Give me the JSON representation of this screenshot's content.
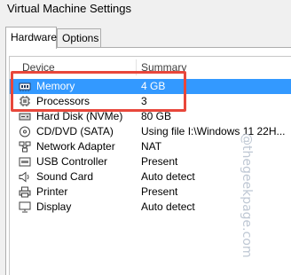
{
  "window": {
    "title": "Virtual Machine Settings"
  },
  "tabs": [
    {
      "label": "Hardware",
      "active": true
    },
    {
      "label": "Options",
      "active": false
    }
  ],
  "list": {
    "columns": {
      "device": "Device",
      "summary": "Summary"
    },
    "rows": [
      {
        "device": "Memory",
        "summary": "4 GB",
        "icon": "memory-icon",
        "selected": true
      },
      {
        "device": "Processors",
        "summary": "3",
        "icon": "processor-icon",
        "selected": false
      },
      {
        "device": "Hard Disk (NVMe)",
        "summary": "80 GB",
        "icon": "hard-disk-icon",
        "selected": false
      },
      {
        "device": "CD/DVD (SATA)",
        "summary": "Using file I:\\Windows 11 22H...",
        "icon": "cd-dvd-icon",
        "selected": false
      },
      {
        "device": "Network Adapter",
        "summary": "NAT",
        "icon": "network-adapter-icon",
        "selected": false
      },
      {
        "device": "USB Controller",
        "summary": "Present",
        "icon": "usb-controller-icon",
        "selected": false
      },
      {
        "device": "Sound Card",
        "summary": "Auto detect",
        "icon": "sound-card-icon",
        "selected": false
      },
      {
        "device": "Printer",
        "summary": "Present",
        "icon": "printer-icon",
        "selected": false
      },
      {
        "device": "Display",
        "summary": "Auto detect",
        "icon": "display-icon",
        "selected": false
      }
    ]
  },
  "watermark": {
    "text": "@thegeekpage.com"
  },
  "colors": {
    "selection": "#3399ff",
    "highlight_box": "#e8473b"
  }
}
